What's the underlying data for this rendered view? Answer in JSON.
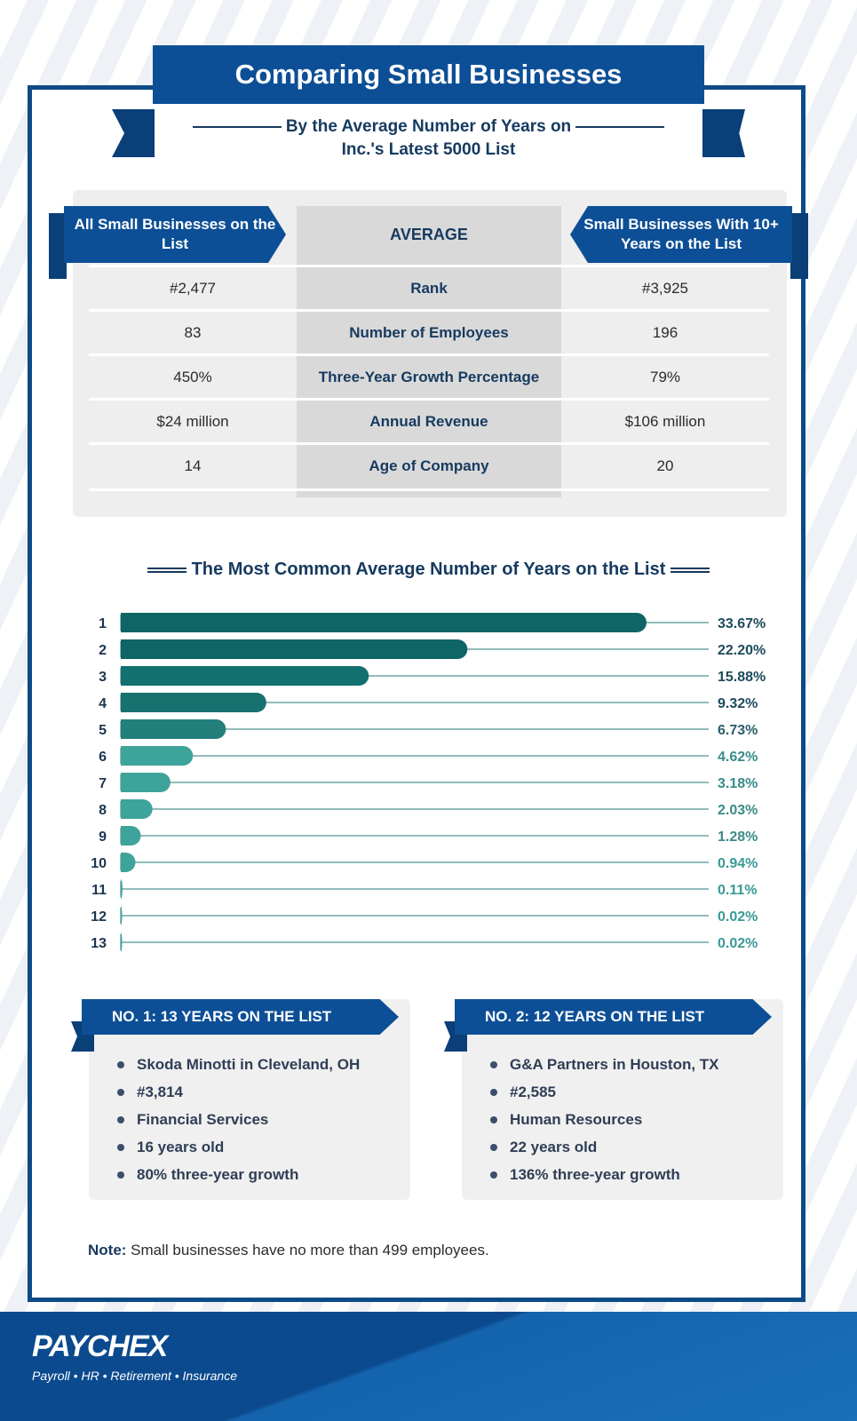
{
  "header": {
    "title": "Comparing Small Businesses",
    "subtitle_line1": "By the Average Number of Years on",
    "subtitle_line2": "Inc.'s Latest 5000 List"
  },
  "comparison": {
    "left_header": "All Small Businesses on the List",
    "mid_header": "AVERAGE",
    "right_header": "Small Businesses With 10+ Years on the List",
    "rows": [
      {
        "metric": "Rank",
        "all": "#2,477",
        "ten_plus": "#3,925"
      },
      {
        "metric": "Number of Employees",
        "all": "83",
        "ten_plus": "196"
      },
      {
        "metric": "Three-Year Growth Percentage",
        "all": "450%",
        "ten_plus": "79%"
      },
      {
        "metric": "Annual Revenue",
        "all": "$24 million",
        "ten_plus": "$106 million"
      },
      {
        "metric": "Age of Company",
        "all": "14",
        "ten_plus": "20"
      }
    ]
  },
  "chart_data": {
    "type": "bar",
    "orientation": "horizontal",
    "title": "The Most Common Average Number of Years on the List",
    "xlabel": "",
    "ylabel": "",
    "categories": [
      "1",
      "2",
      "3",
      "4",
      "5",
      "6",
      "7",
      "8",
      "9",
      "10",
      "11",
      "12",
      "13"
    ],
    "values": [
      33.67,
      22.2,
      15.88,
      9.32,
      6.73,
      4.62,
      3.18,
      2.03,
      1.28,
      0.94,
      0.11,
      0.02,
      0.02
    ],
    "value_labels": [
      "33.67%",
      "22.20%",
      "15.88%",
      "9.32%",
      "6.73%",
      "4.62%",
      "3.18%",
      "2.03%",
      "1.28%",
      "0.94%",
      "0.11%",
      "0.02%",
      "0.02%"
    ],
    "xlim": [
      0,
      33.67
    ],
    "grid": false,
    "legend": "none",
    "colors": [
      "#0f6466",
      "#0f6466",
      "#12706f",
      "#17716f",
      "#237f7b",
      "#3ea39a",
      "#3ea39a",
      "#3ea39a",
      "#3ea39a",
      "#3ea39a",
      "#3ea39a",
      "#3ea39a",
      "#3ea39a"
    ],
    "label_colors": [
      "#1d4b5c",
      "#1d4b5c",
      "#1d4b5c",
      "#1d4b5c",
      "#2a5d6b",
      "#3a8a89",
      "#3a8a89",
      "#3a8a89",
      "#3a8a89",
      "#3a9a96",
      "#3a9a96",
      "#3a9a96",
      "#3a9a96"
    ]
  },
  "cards": [
    {
      "title": "NO. 1: 13 YEARS ON THE LIST",
      "items": [
        "Skoda Minotti in Cleveland, OH",
        "#3,814",
        "Financial Services",
        "16 years old",
        "80% three-year growth"
      ]
    },
    {
      "title": "NO. 2: 12 YEARS ON THE LIST",
      "items": [
        "G&A Partners in Houston, TX",
        "#2,585",
        "Human Resources",
        "22 years old",
        "136% three-year growth"
      ]
    }
  ],
  "note": {
    "label": "Note:",
    "text": " Small businesses have no more than 499 employees."
  },
  "footer": {
    "logo": "PAYCHEX",
    "tagline": "Payroll • HR • Retirement • Insurance"
  }
}
